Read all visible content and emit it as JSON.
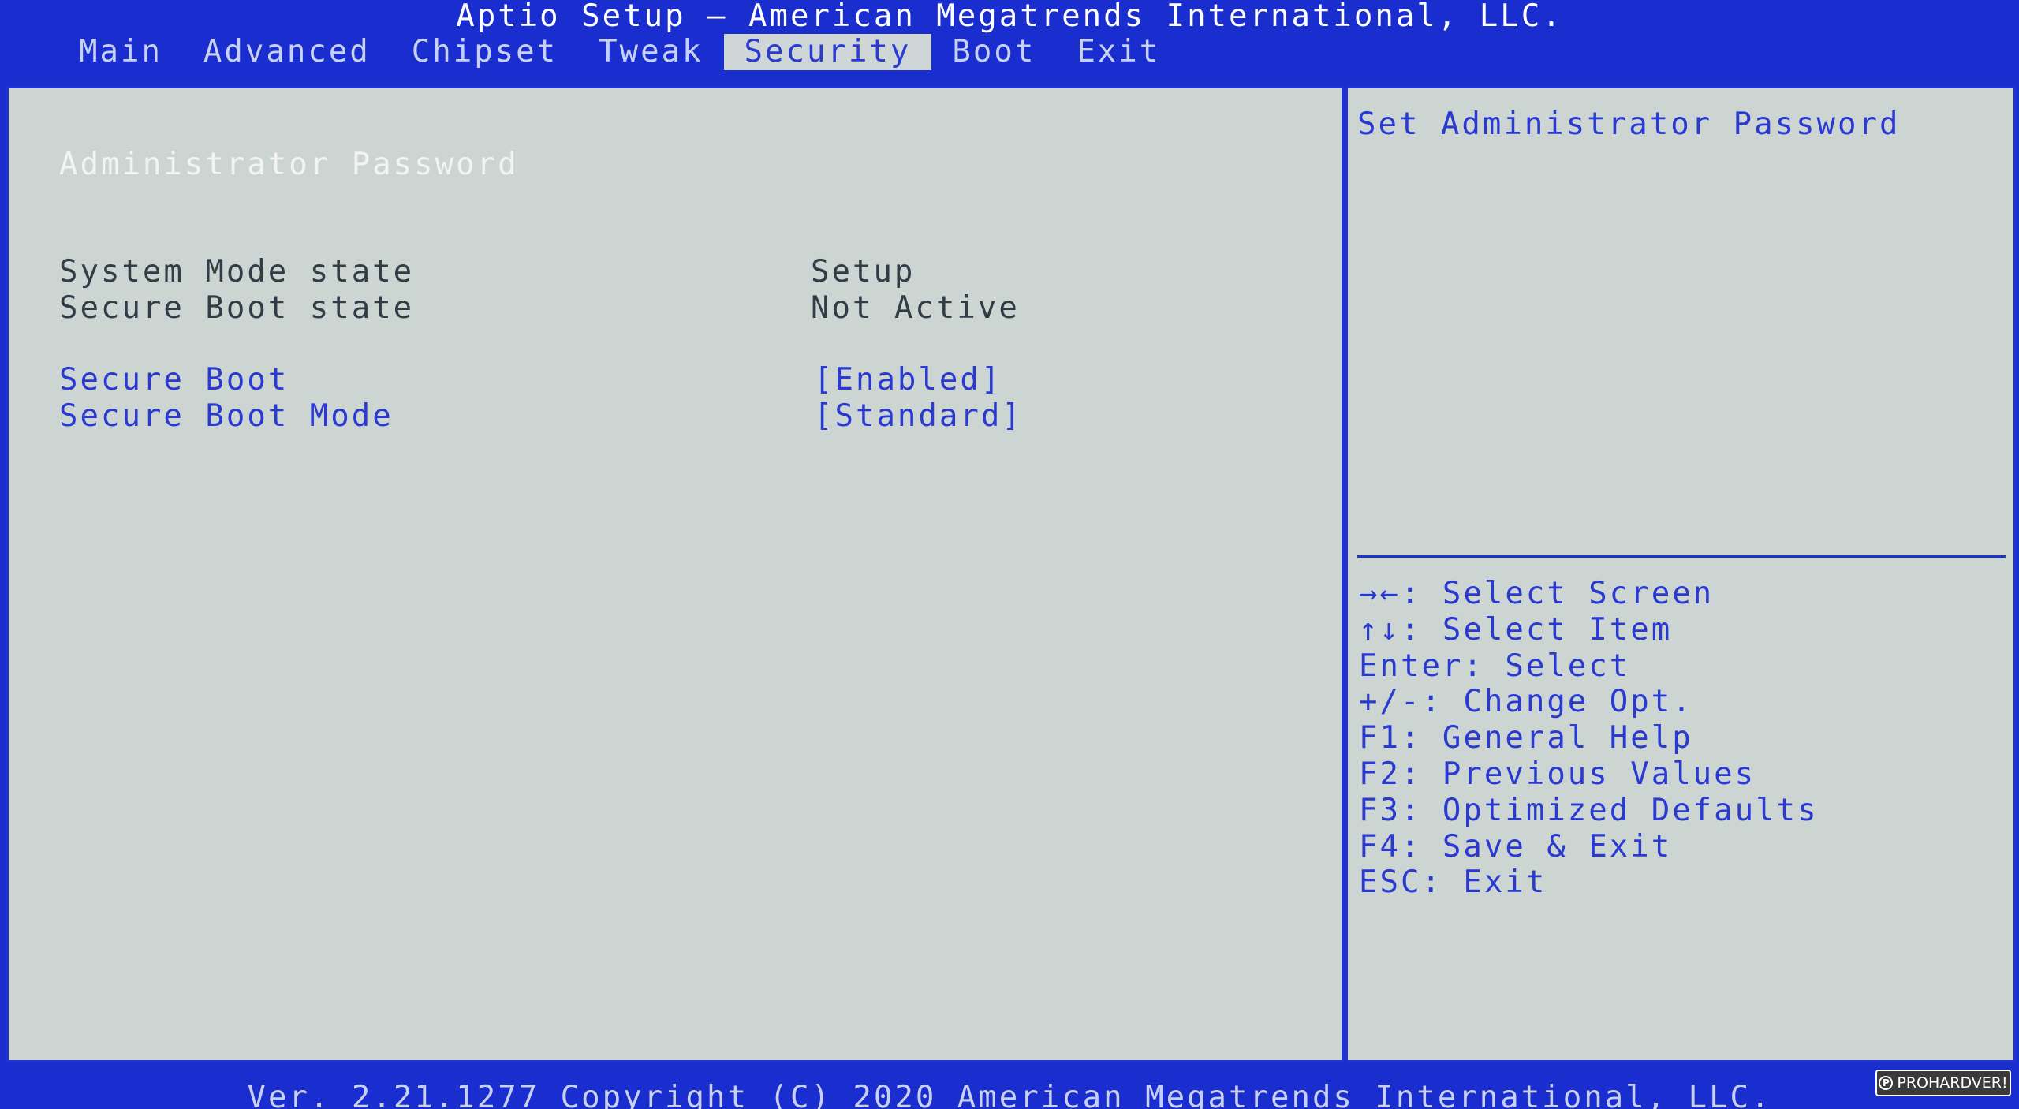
{
  "header": {
    "title": "Aptio Setup – American Megatrends International, LLC."
  },
  "tabs": [
    {
      "label": "Main"
    },
    {
      "label": "Advanced"
    },
    {
      "label": "Chipset"
    },
    {
      "label": "Tweak"
    },
    {
      "label": "Security",
      "active": true
    },
    {
      "label": "Boot"
    },
    {
      "label": "Exit"
    }
  ],
  "main": {
    "admin_password": "Administrator Password",
    "system_mode_label": "System Mode state",
    "system_mode_value": "Setup",
    "secure_boot_state_label": "Secure Boot state",
    "secure_boot_state_value": "Not Active",
    "secure_boot_label": "Secure Boot",
    "secure_boot_value": "[Enabled]",
    "secure_boot_mode_label": "Secure Boot Mode",
    "secure_boot_mode_value": "[Standard]"
  },
  "help": {
    "description": "Set Administrator Password",
    "keys": [
      "→←: Select Screen",
      "↑↓: Select Item",
      "Enter: Select",
      "+/-: Change Opt.",
      "F1: General Help",
      "F2: Previous Values",
      "F3: Optimized Defaults",
      "F4: Save & Exit",
      "ESC: Exit"
    ]
  },
  "footer": {
    "text": "Ver. 2.21.1277 Copyright (C) 2020 American Megatrends International, LLC."
  },
  "watermark": {
    "text": "PROHARDVER!"
  },
  "colors": {
    "frame_blue": "#1a2ed0",
    "panel_gray": "#cdd5d3",
    "link_blue": "#2a3ad0"
  }
}
